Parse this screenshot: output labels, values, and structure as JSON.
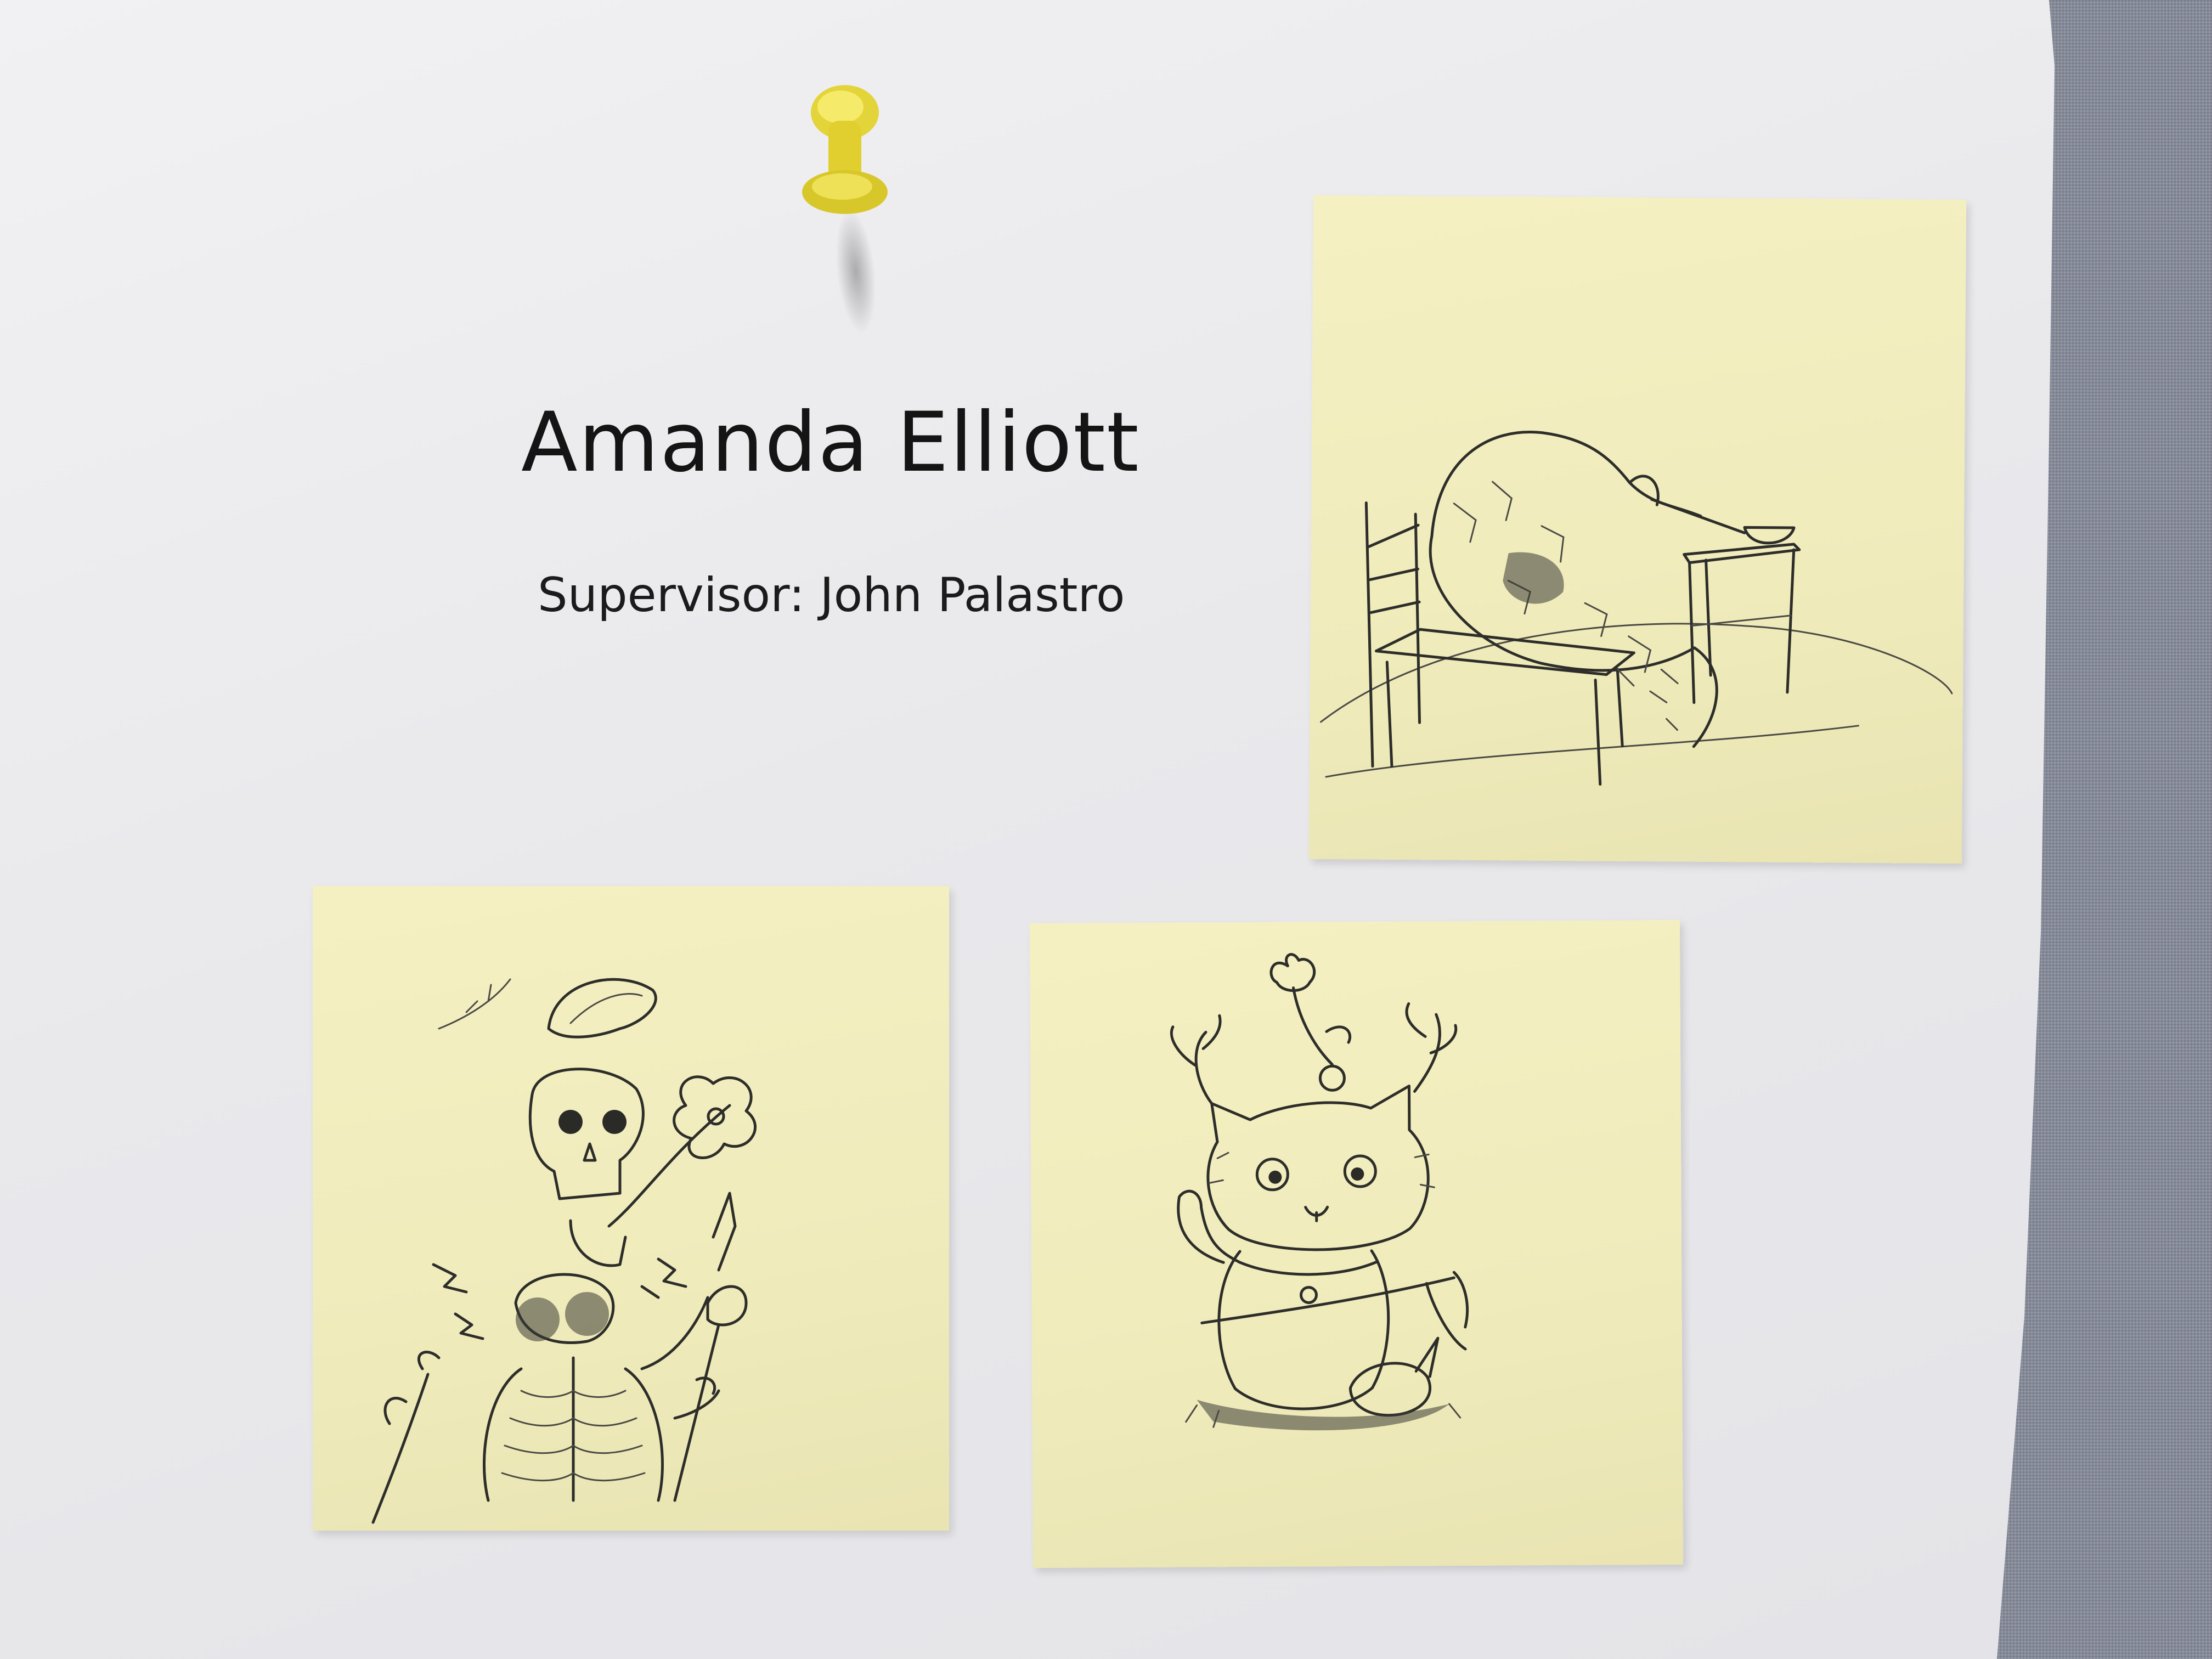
{
  "poster": {
    "name": "Amanda Elliott",
    "supervisor": "Supervisor: John Palastro"
  },
  "colors": {
    "paper": "#ececef",
    "sticky_note": "#f1edbe",
    "push_pin": "#f2e24a",
    "fabric_wall": "#878c9b"
  },
  "objects": {
    "push_pin": "yellow push pin",
    "notes": [
      "pangolin-chair-sketch",
      "skeleton-sketch",
      "antlered-cat-sketch"
    ]
  }
}
